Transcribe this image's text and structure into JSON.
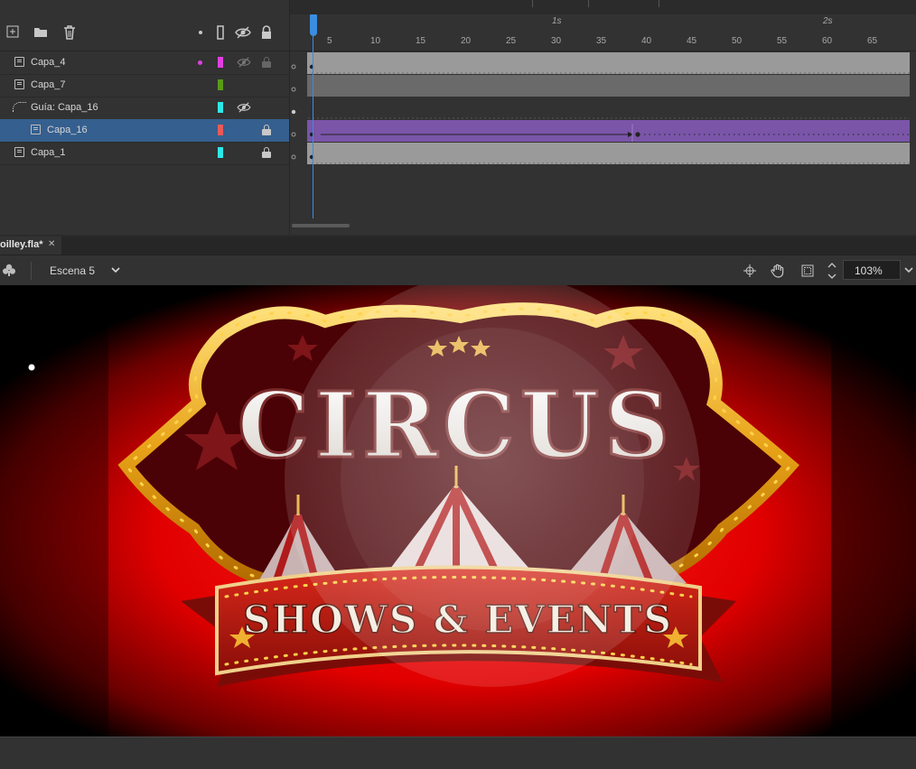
{
  "timeline": {
    "ruler_frames": [
      "5",
      "10",
      "15",
      "20",
      "25",
      "30",
      "35",
      "40",
      "45",
      "50",
      "55",
      "60",
      "65"
    ],
    "ruler_seconds": [
      "1s",
      "2s"
    ],
    "layers": [
      {
        "name": "Capa_4",
        "color": "#e040e0",
        "has_dot": true,
        "hidden": true,
        "locked": true,
        "selected": false,
        "guide": false,
        "indent": false
      },
      {
        "name": "Capa_7",
        "color": "#5a9a18",
        "has_dot": false,
        "hidden": false,
        "locked": false,
        "selected": false,
        "guide": false,
        "indent": false
      },
      {
        "name": "Guía: Capa_16",
        "color": "#2ee8e8",
        "has_dot": false,
        "hidden": true,
        "locked": false,
        "selected": false,
        "guide": true,
        "indent": false
      },
      {
        "name": "Capa_16",
        "color": "#e85a5a",
        "has_dot": false,
        "hidden": false,
        "locked": true,
        "selected": true,
        "guide": false,
        "indent": true
      },
      {
        "name": "Capa_1",
        "color": "#2ee8e8",
        "has_dot": false,
        "hidden": false,
        "locked": true,
        "selected": false,
        "guide": false,
        "indent": false
      }
    ]
  },
  "document": {
    "tab_title": "oilley.fla*",
    "scene_label": "Escena 5",
    "zoom": "103%"
  },
  "artwork": {
    "title_text": "CIRCUS",
    "banner_text": "SHOWS & EVENTS"
  },
  "colors": {
    "accent_blue": "#3c8ce0",
    "tween_purple": "#7a55a8",
    "stage_red": "#e10000"
  }
}
